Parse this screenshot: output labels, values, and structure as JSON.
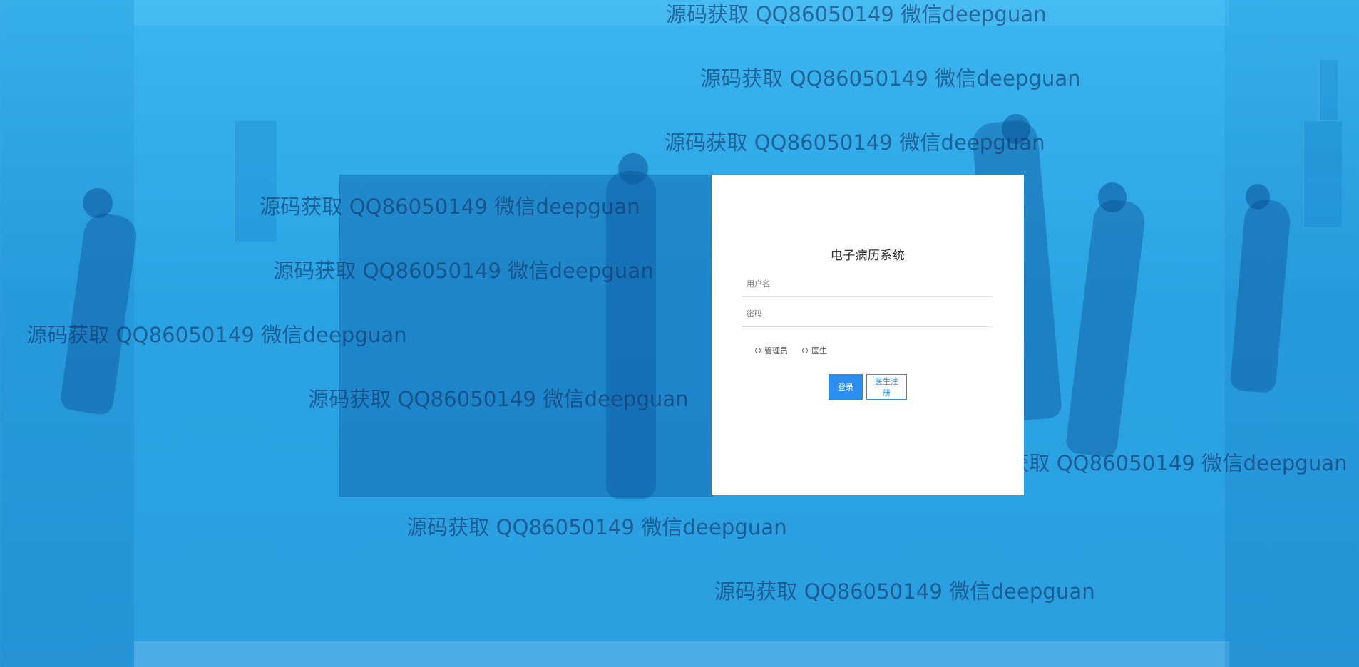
{
  "colors": {
    "background": "#2aa3e4",
    "watermark": "#143564",
    "panel_overlay": "#0b5ea5",
    "card_background": "#ffffff",
    "primary_button": "#2c8ff0"
  },
  "watermarks": [
    "源码获取 QQ86050149 微信deepguan",
    "源码获取 QQ86050149 微信deepguan",
    "源码获取 QQ86050149 微信deepguan",
    "源码获取 QQ86050149 微信deepguan",
    "源码获取 QQ86050149 微信deepguan",
    "源码获取 QQ86050149 微信deepguan",
    "源码获取 QQ86050149 微信deepguan",
    "源码获取 QQ86050149 微信deepguan",
    "源码获取 QQ86050149 微信deepguan",
    "源码获取 QQ86050149 微信deepguan"
  ],
  "login": {
    "title": "电子病历系统",
    "username_placeholder": "用户名",
    "password_placeholder": "密码",
    "roles": [
      "管理员",
      "医生"
    ],
    "login_button": "登录",
    "register_button": "医生注册"
  }
}
